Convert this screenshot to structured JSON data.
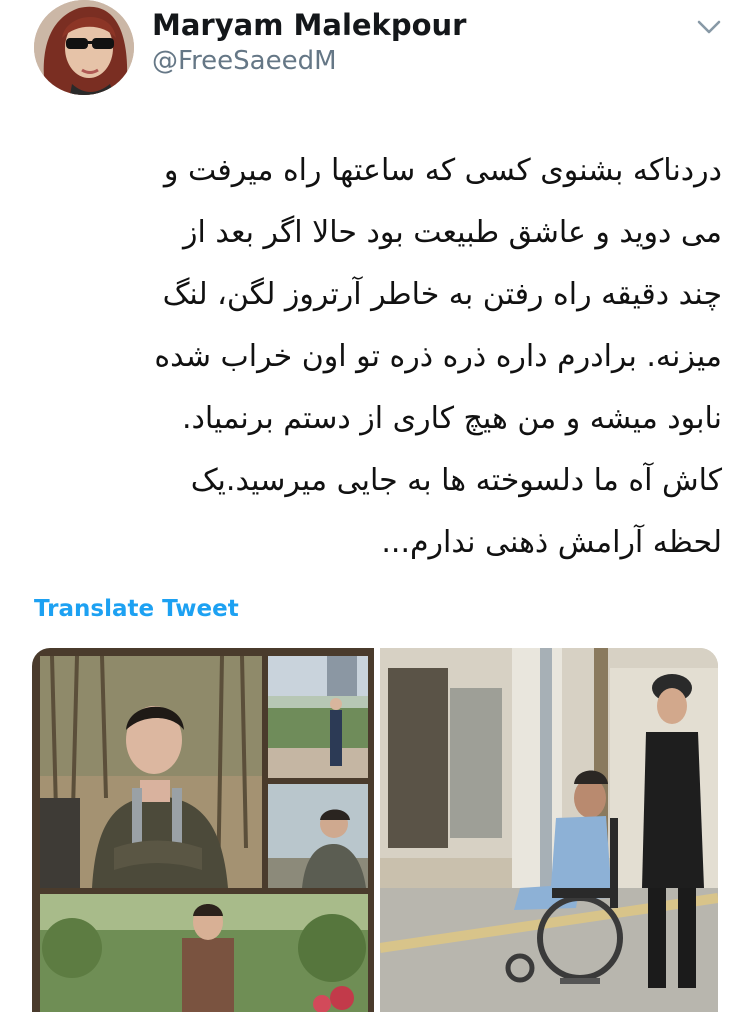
{
  "tweet": {
    "author_name": "Maryam Malekpour",
    "author_handle": "@FreeSaeedM",
    "lines": [
      "دردناکه بشنوی کسی که ساعتها راه میرفت و",
      "می دوید و عاشق طبیعت بود حالا اگر بعد از",
      "چند دقیقه راه رفتن به خاطر آرتروز لگن، لنگ",
      "میزنه. برادرم داره ذره ذره تو اون خراب شده",
      "نابود میشه و من هیچ کاری از دستم برنمیاد.",
      "کاش آه ما دلسوخته ها به جایی میرسید.یک",
      "لحظه آرامش ذهنی ندارم..."
    ],
    "translate_label": "Translate Tweet"
  },
  "icons": {
    "menu": "chevron-down-icon"
  },
  "colors": {
    "link": "#1da1f2",
    "handle": "#657786"
  }
}
